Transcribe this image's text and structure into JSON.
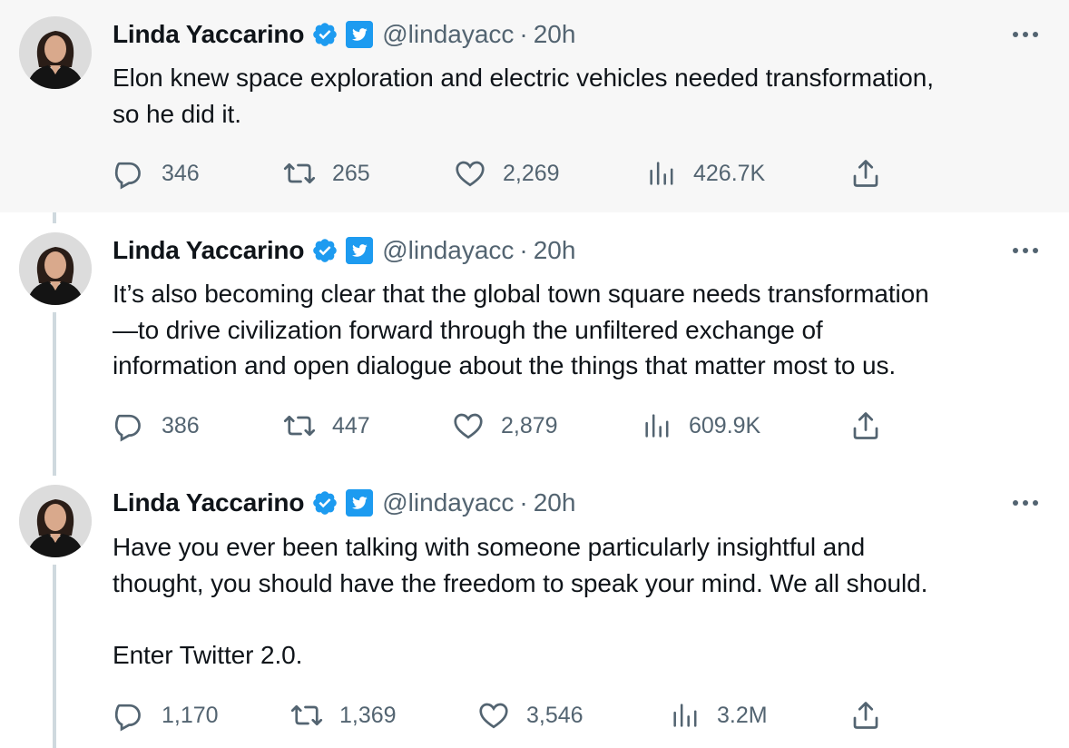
{
  "colors": {
    "accent": "#1d9bf0",
    "secondary_text": "#536471",
    "thread_line": "#cfd9de",
    "highlight_bg": "#f7f7f7"
  },
  "tweets": [
    {
      "author": {
        "name": "Linda Yaccarino",
        "handle": "@lindayacc",
        "badge_icons": [
          "verified-badge-icon",
          "twitter-bird-badge-icon"
        ]
      },
      "separator": "·",
      "time": "20h",
      "text": "Elon knew space exploration and electric vehicles needed transformation,\nso he did it.",
      "stats": {
        "replies": "346",
        "retweets": "265",
        "likes": "2,269",
        "views": "426.7K"
      }
    },
    {
      "author": {
        "name": "Linda Yaccarino",
        "handle": "@lindayacc",
        "badge_icons": [
          "verified-badge-icon",
          "twitter-bird-badge-icon"
        ]
      },
      "separator": "·",
      "time": "20h",
      "text": "It’s also becoming clear that the global town square needs transformation\n—to drive civilization forward through the unfiltered exchange of\ninformation and open dialogue about the things that matter most to us.",
      "stats": {
        "replies": "386",
        "retweets": "447",
        "likes": "2,879",
        "views": "609.9K"
      }
    },
    {
      "author": {
        "name": "Linda Yaccarino",
        "handle": "@lindayacc",
        "badge_icons": [
          "verified-badge-icon",
          "twitter-bird-badge-icon"
        ]
      },
      "separator": "·",
      "time": "20h",
      "text": "Have you ever been talking with someone particularly insightful and\nthought, you should have the freedom to speak your mind. We all should.\n\nEnter Twitter 2.0.",
      "stats": {
        "replies": "1,170",
        "retweets": "1,369",
        "likes": "3,546",
        "views": "3.2M"
      }
    }
  ]
}
